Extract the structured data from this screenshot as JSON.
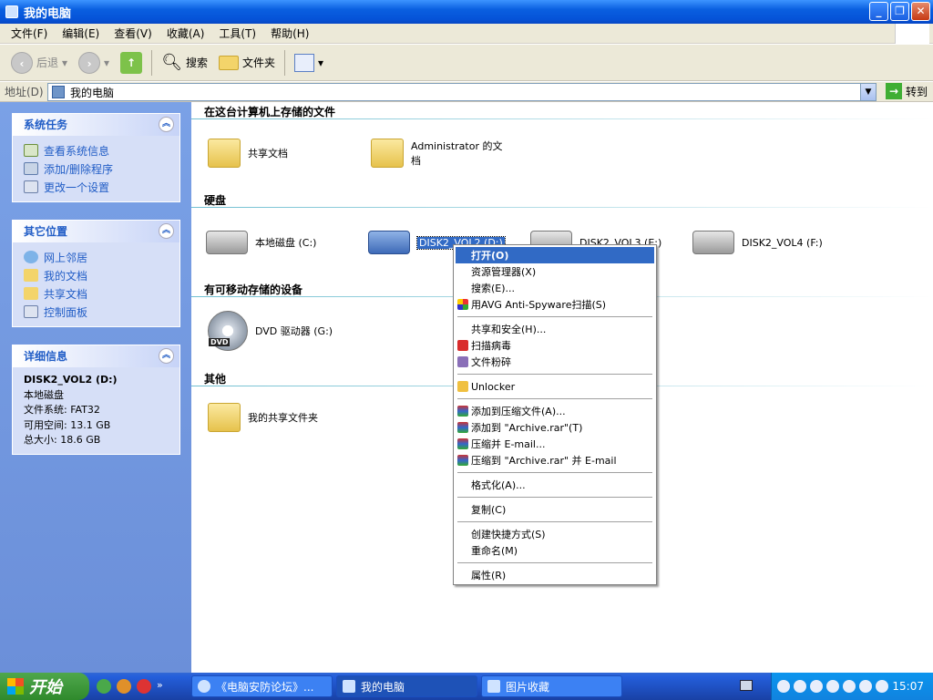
{
  "window": {
    "title": "我的电脑"
  },
  "menubar": [
    "文件(F)",
    "编辑(E)",
    "查看(V)",
    "收藏(A)",
    "工具(T)",
    "帮助(H)"
  ],
  "toolbar": {
    "back": "后退",
    "search": "搜索",
    "folders": "文件夹"
  },
  "address": {
    "label": "地址(D)",
    "value": "我的电脑",
    "go": "转到"
  },
  "tasks": {
    "title": "系统任务",
    "items": [
      "查看系统信息",
      "添加/删除程序",
      "更改一个设置"
    ]
  },
  "places": {
    "title": "其它位置",
    "items": [
      "网上邻居",
      "我的文档",
      "共享文档",
      "控制面板"
    ]
  },
  "details": {
    "title": "详细信息",
    "name": "DISK2_VOL2 (D:)",
    "type": "本地磁盘",
    "fs": "文件系统: FAT32",
    "free": "可用空间: 13.1 GB",
    "total": "总大小: 18.6 GB"
  },
  "groups": {
    "stored": "在这台计算机上存储的文件",
    "hdd": "硬盘",
    "removable": "有可移动存储的设备",
    "other": "其他"
  },
  "files": {
    "shared": "共享文档",
    "admin_line1": "Administrator 的文",
    "admin_line2": "档"
  },
  "drives": {
    "c": "本地磁盘 (C:)",
    "d": "DISK2_VOL2 (D:)",
    "e": "DISK2_VOL3 (E:)",
    "f": "DISK2_VOL4 (F:)",
    "dvd": "DVD 驱动器 (G:)",
    "myshared": "我的共享文件夹"
  },
  "context": [
    "打开(O)",
    "资源管理器(X)",
    "搜索(E)...",
    "用AVG Anti-Spyware扫描(S)",
    "共享和安全(H)...",
    "扫描病毒",
    "文件粉碎",
    "Unlocker",
    "添加到压缩文件(A)...",
    "添加到 \"Archive.rar\"(T)",
    "压缩并 E-mail...",
    "压缩到 \"Archive.rar\" 并 E-mail",
    "格式化(A)...",
    "复制(C)",
    "创建快捷方式(S)",
    "重命名(M)",
    "属性(R)"
  ],
  "taskbar": {
    "start": "开始",
    "tasks": [
      "《电脑安防论坛》...",
      "我的电脑",
      "图片收藏"
    ],
    "clock": "15:07"
  },
  "colors": {
    "titlebar": "#0553d8",
    "leftpane": "#7aa1e6",
    "highlight": "#316ac5",
    "taskbar": "#245edb"
  }
}
